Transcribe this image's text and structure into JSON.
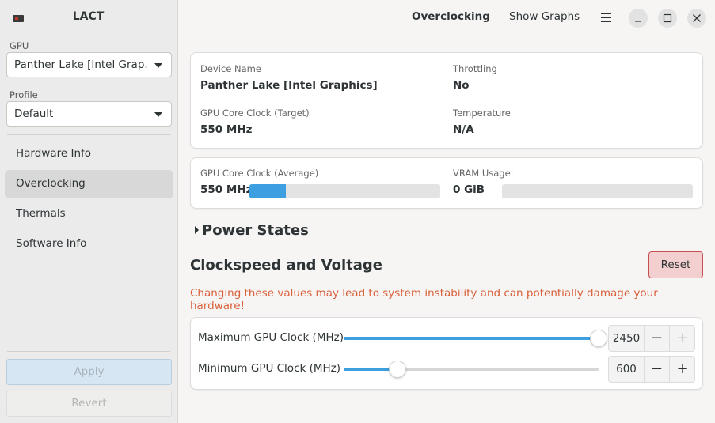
{
  "app": {
    "title": "LACT"
  },
  "sidebar": {
    "gpu_label": "GPU",
    "gpu_value": "Panther Lake [Intel Grap...",
    "profile_label": "Profile",
    "profile_value": "Default",
    "nav": [
      {
        "label": "Hardware Info"
      },
      {
        "label": "Overclocking"
      },
      {
        "label": "Thermals"
      },
      {
        "label": "Software Info"
      }
    ],
    "active_nav": "Overclocking",
    "apply_label": "Apply",
    "revert_label": "Revert"
  },
  "header": {
    "tabs": [
      {
        "label": "Overclocking"
      },
      {
        "label": "Show Graphs"
      }
    ],
    "active_tab": "Overclocking"
  },
  "info": {
    "device_name_label": "Device Name",
    "device_name_value": "Panther Lake [Intel Graphics]",
    "throttling_label": "Throttling",
    "throttling_value": "No",
    "core_clock_target_label": "GPU Core Clock (Target)",
    "core_clock_target_value": "550 MHz",
    "temperature_label": "Temperature",
    "temperature_value": "N/A"
  },
  "usage": {
    "core_clock_avg_label": "GPU Core Clock (Average)",
    "core_clock_avg_value": "550 MHz",
    "core_clock_avg_fraction": 0.19,
    "vram_label": "VRAM Usage:",
    "vram_value": "0 GiB",
    "vram_fraction": 0.0
  },
  "power_states": {
    "title": "Power States",
    "expanded": false
  },
  "clockspeed": {
    "title": "Clockspeed and Voltage",
    "reset_label": "Reset",
    "warning": "Changing these values may lead to system instability and can potentially damage your hardware!",
    "sliders": [
      {
        "label": "Maximum GPU Clock (MHz)",
        "value": "2450",
        "fraction": 1.0,
        "plus_enabled": false
      },
      {
        "label": "Minimum GPU Clock (MHz)",
        "value": "600",
        "fraction": 0.21,
        "plus_enabled": true
      }
    ]
  },
  "colors": {
    "accent": "#3d9fe0",
    "warning": "#d9603a",
    "reset_bg": "#f4cfcf"
  }
}
